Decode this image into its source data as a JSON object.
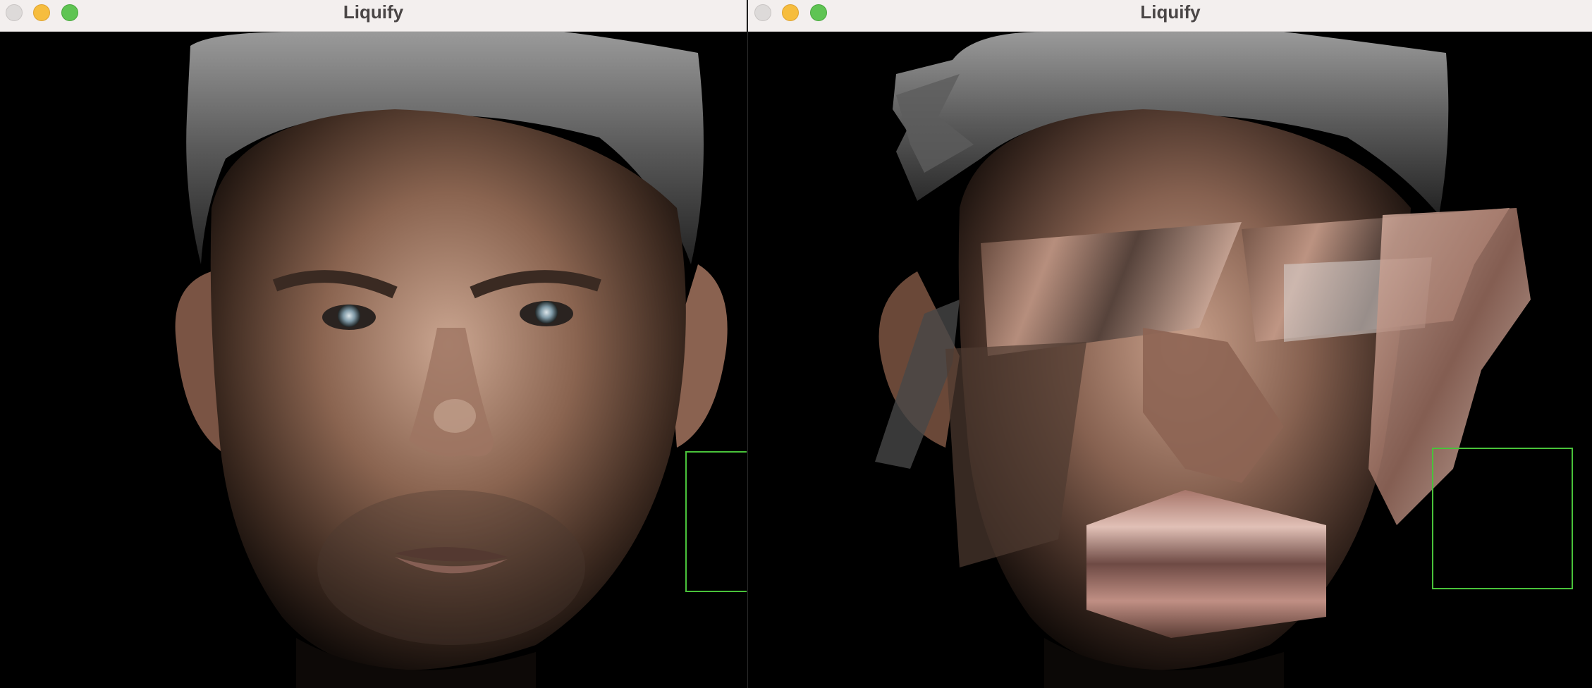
{
  "windows": [
    {
      "title": "Liquify"
    },
    {
      "title": "Liquify"
    }
  ],
  "colors": {
    "titlebar": "#f3efee",
    "close": "#dddad9",
    "minimize": "#f6bd3e",
    "maximize": "#5fc453",
    "roi_border": "#49c23a",
    "canvas": "#000000"
  },
  "icons": [
    "close-icon",
    "minimize-icon",
    "maximize-icon"
  ]
}
